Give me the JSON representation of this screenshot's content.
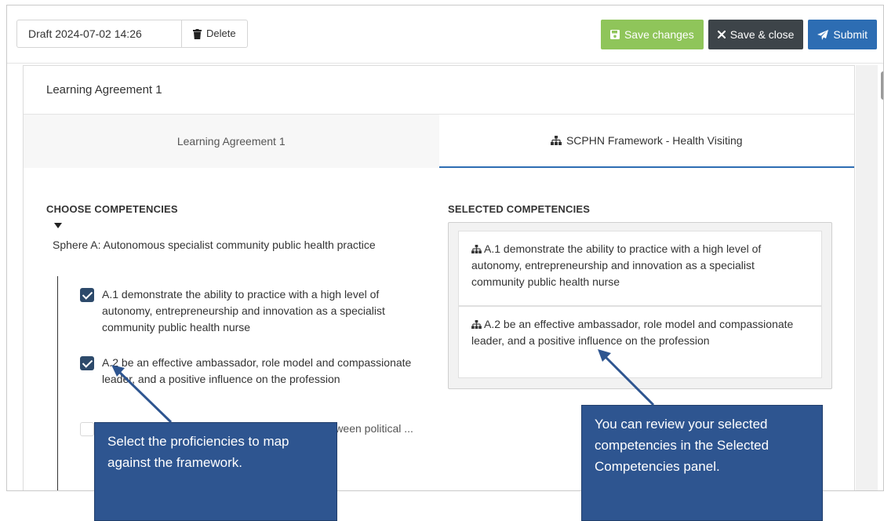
{
  "toolbar": {
    "draft_label": "Draft 2024-07-02 14:26",
    "delete_label": "Delete",
    "save_label": "Save changes",
    "save_close_label": "Save & close",
    "submit_label": "Submit"
  },
  "card": {
    "title": "Learning Agreement 1",
    "tabs": [
      {
        "label": "Learning Agreement 1",
        "active": false
      },
      {
        "label": "SCPHN Framework - Health Visiting",
        "active": true
      }
    ]
  },
  "choose": {
    "title": "CHOOSE COMPETENCIES",
    "sphere_label": "Sphere A: Autonomous specialist community public health practice",
    "items": [
      {
        "text": "A.1 demonstrate the ability to practice with a high level of autonomy, entrepreneurship and innovation as a specialist community public health nurse",
        "checked": true
      },
      {
        "text": "A.2 be an effective ambassador, role model and compassionate leader, and a positive influence on the profession",
        "checked": true
      },
      {
        "text": "A.3 use an expanded knowledge of the links between political ... to drive and ... ce",
        "checked": false
      }
    ]
  },
  "selected": {
    "title": "SELECTED COMPETENCIES",
    "items": [
      {
        "text": "A.1 demonstrate the ability to practice with a high level of autonomy, entrepreneurship and innovation as a specialist community public health nurse"
      },
      {
        "text": "A.2 be an effective ambassador, role model and compassionate leader, and a positive influence on the profession"
      }
    ]
  },
  "callouts": {
    "left": "Select the proficiencies to map against the framework.",
    "right": "You can review your selected competencies in the Selected Competencies panel."
  },
  "colors": {
    "save": "#8fc55a",
    "close": "#3d4449",
    "submit": "#2d6db3",
    "callout": "#2e5590"
  }
}
